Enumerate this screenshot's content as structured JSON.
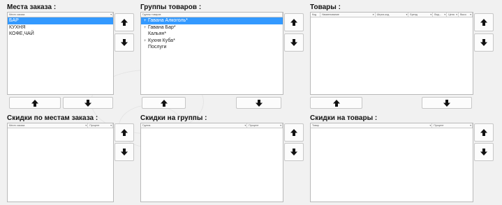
{
  "sections": {
    "places": {
      "title": "Места заказа :",
      "column": "Место заказа",
      "items": [
        "БАР",
        "КУХНЯ",
        "КОФЕ,ЧАЙ"
      ],
      "selected_index": 0
    },
    "groups": {
      "title": "Группы товаров :",
      "column": "Группы товаров",
      "items": [
        {
          "label": "Гавана Алкоголь*",
          "expandable": true
        },
        {
          "label": "Гавана Бар*",
          "expandable": true
        },
        {
          "label": "Кальян*",
          "expandable": false
        },
        {
          "label": "Кухня Куба*",
          "expandable": true
        },
        {
          "label": "Послуги",
          "expandable": false
        }
      ],
      "selected_index": 0
    },
    "products": {
      "title": "Товары :",
      "columns": [
        "Код",
        "Наименование",
        "Штрих-код",
        "Бренд",
        "Вид...",
        "Цена",
        "Высо"
      ]
    },
    "place_discounts": {
      "title": "Скидки по местам заказа :",
      "columns": [
        "Место заказа",
        "Процент"
      ]
    },
    "group_discounts": {
      "title": "Скидки на группы :",
      "columns": [
        "Группа",
        "Процент"
      ]
    },
    "product_discounts": {
      "title": "Скидки на товары :",
      "columns": [
        "Товар",
        "Процент"
      ]
    }
  },
  "icons": {
    "up": "arrow-up-icon",
    "down": "arrow-down-icon",
    "expand": "tree-expand-icon",
    "dropdown": "column-dropdown-icon"
  },
  "colors": {
    "selection": "#3399ff",
    "background": "#f1f1f1",
    "arrow": "#111111"
  }
}
